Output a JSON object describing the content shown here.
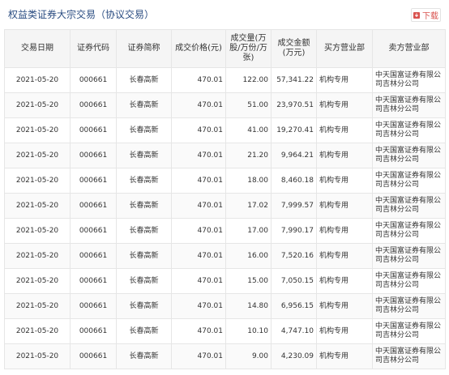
{
  "title": "权益类证券大宗交易（协议交易）",
  "download_label": "下载",
  "colors": {
    "title": "#2b4d82",
    "download": "#d9534f",
    "header_bg": "#f5f5f5"
  },
  "icons": {
    "download": "download-icon"
  },
  "columns": [
    "交易日期",
    "证券代码",
    "证券简称",
    "成交价格(元)",
    "成交量(万股/万份/万张)",
    "成交金额(万元)",
    "买方营业部",
    "卖方营业部"
  ],
  "rows": [
    {
      "date": "2021-05-20",
      "code": "000661",
      "name": "长春高新",
      "price": "470.01",
      "volume": "122.00",
      "amount": "57,341.22",
      "buyer": "机构专用",
      "seller": "中天国富证券有限公司吉林分公司"
    },
    {
      "date": "2021-05-20",
      "code": "000661",
      "name": "长春高新",
      "price": "470.01",
      "volume": "51.00",
      "amount": "23,970.51",
      "buyer": "机构专用",
      "seller": "中天国富证券有限公司吉林分公司"
    },
    {
      "date": "2021-05-20",
      "code": "000661",
      "name": "长春高新",
      "price": "470.01",
      "volume": "41.00",
      "amount": "19,270.41",
      "buyer": "机构专用",
      "seller": "中天国富证券有限公司吉林分公司"
    },
    {
      "date": "2021-05-20",
      "code": "000661",
      "name": "长春高新",
      "price": "470.01",
      "volume": "21.20",
      "amount": "9,964.21",
      "buyer": "机构专用",
      "seller": "中天国富证券有限公司吉林分公司"
    },
    {
      "date": "2021-05-20",
      "code": "000661",
      "name": "长春高新",
      "price": "470.01",
      "volume": "18.00",
      "amount": "8,460.18",
      "buyer": "机构专用",
      "seller": "中天国富证券有限公司吉林分公司"
    },
    {
      "date": "2021-05-20",
      "code": "000661",
      "name": "长春高新",
      "price": "470.01",
      "volume": "17.02",
      "amount": "7,999.57",
      "buyer": "机构专用",
      "seller": "中天国富证券有限公司吉林分公司"
    },
    {
      "date": "2021-05-20",
      "code": "000661",
      "name": "长春高新",
      "price": "470.01",
      "volume": "17.00",
      "amount": "7,990.17",
      "buyer": "机构专用",
      "seller": "中天国富证券有限公司吉林分公司"
    },
    {
      "date": "2021-05-20",
      "code": "000661",
      "name": "长春高新",
      "price": "470.01",
      "volume": "16.00",
      "amount": "7,520.16",
      "buyer": "机构专用",
      "seller": "中天国富证券有限公司吉林分公司"
    },
    {
      "date": "2021-05-20",
      "code": "000661",
      "name": "长春高新",
      "price": "470.01",
      "volume": "15.00",
      "amount": "7,050.15",
      "buyer": "机构专用",
      "seller": "中天国富证券有限公司吉林分公司"
    },
    {
      "date": "2021-05-20",
      "code": "000661",
      "name": "长春高新",
      "price": "470.01",
      "volume": "14.80",
      "amount": "6,956.15",
      "buyer": "机构专用",
      "seller": "中天国富证券有限公司吉林分公司"
    },
    {
      "date": "2021-05-20",
      "code": "000661",
      "name": "长春高新",
      "price": "470.01",
      "volume": "10.10",
      "amount": "4,747.10",
      "buyer": "机构专用",
      "seller": "中天国富证券有限公司吉林分公司"
    },
    {
      "date": "2021-05-20",
      "code": "000661",
      "name": "长春高新",
      "price": "470.01",
      "volume": "9.00",
      "amount": "4,230.09",
      "buyer": "机构专用",
      "seller": "中天国富证券有限公司吉林分公司"
    }
  ]
}
